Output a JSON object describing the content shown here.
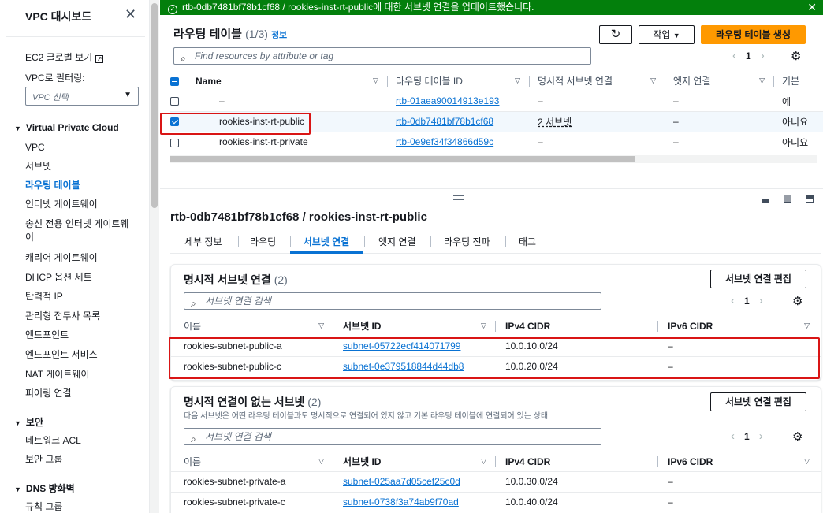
{
  "sidebar": {
    "title": "VPC 대시보드",
    "ec2_link": "EC2 글로벌 보기",
    "filter_label": "VPC로 필터링:",
    "filter_placeholder": "VPC 선택",
    "section_vpc": "Virtual Private Cloud",
    "items": [
      "VPC",
      "서브넷",
      "라우팅 테이블",
      "인터넷 게이트웨이",
      "송신 전용 인터넷 게이트웨이",
      "캐리어 게이트웨이",
      "DHCP 옵션 세트",
      "탄력적 IP",
      "관리형 접두사 목록",
      "엔드포인트",
      "엔드포인트 서비스",
      "NAT 게이트웨이",
      "피어링 연결"
    ],
    "section_security": "보안",
    "security_items": [
      "네트워크 ACL",
      "보안 그룹"
    ],
    "section_dns": "DNS 방화벽",
    "dns_items": [
      "규칙 그룹"
    ]
  },
  "banner": {
    "message": "rtb-0db7481bf78b1cf68 / rookies-inst-rt-public에 대한 서브넷 연결을 업데이트했습니다."
  },
  "route_tables": {
    "title": "라우팅 테이블",
    "count": "(1/3)",
    "info": "정보",
    "refresh_icon": "refresh-icon",
    "actions_label": "작업",
    "create_label": "라우팅 테이블 생성",
    "search_placeholder": "Find resources by attribute or tag",
    "page": "1",
    "columns": [
      "Name",
      "라우팅 테이블 ID",
      "명시적 서브넷 연결",
      "엣지 연결",
      "기본"
    ],
    "rows": [
      {
        "name": "–",
        "id": "rtb-01aea90014913e193",
        "explicit": "–",
        "edge": "–",
        "main": "예",
        "selected": false
      },
      {
        "name": "rookies-inst-rt-public",
        "id": "rtb-0db7481bf78b1cf68",
        "explicit": "2 서브넷",
        "edge": "–",
        "main": "아니요",
        "selected": true
      },
      {
        "name": "rookies-inst-rt-private",
        "id": "rtb-0e9ef34f34866d59c",
        "explicit": "–",
        "edge": "–",
        "main": "아니요",
        "selected": false
      }
    ]
  },
  "details": {
    "title": "rtb-0db7481bf78b1cf68 / rookies-inst-rt-public",
    "tabs": [
      "세부 정보",
      "라우팅",
      "서브넷 연결",
      "엣지 연결",
      "라우팅 전파",
      "태그"
    ],
    "active_tab": "서브넷 연결"
  },
  "explicit_assoc": {
    "title": "명시적 서브넷 연결",
    "count": "(2)",
    "edit_label": "서브넷 연결 편집",
    "search_placeholder": "서브넷 연결 검색",
    "page": "1",
    "columns": [
      "이름",
      "서브넷 ID",
      "IPv4 CIDR",
      "IPv6 CIDR"
    ],
    "rows": [
      {
        "name": "rookies-subnet-public-a",
        "id": "subnet-05722ecf414071799",
        "ipv4": "10.0.10.0/24",
        "ipv6": "–"
      },
      {
        "name": "rookies-subnet-public-c",
        "id": "subnet-0e379518844d44db8",
        "ipv4": "10.0.20.0/24",
        "ipv6": "–"
      }
    ]
  },
  "unassoc": {
    "title": "명시적 연결이 없는 서브넷",
    "count": "(2)",
    "edit_label": "서브넷 연결 편집",
    "description": "다음 서브넷은 어떤 라우팅 테이블과도 명시적으로 연결되어 있지 않고 기본 라우팅 테이블에 연결되어 있는 상태:",
    "search_placeholder": "서브넷 연결 검색",
    "page": "1",
    "columns": [
      "이름",
      "서브넷 ID",
      "IPv4 CIDR",
      "IPv6 CIDR"
    ],
    "rows": [
      {
        "name": "rookies-subnet-private-a",
        "id": "subnet-025aa7d05cef25c0d",
        "ipv4": "10.0.30.0/24",
        "ipv6": "–"
      },
      {
        "name": "rookies-subnet-private-c",
        "id": "subnet-0738f3a74ab9f70ad",
        "ipv4": "10.0.40.0/24",
        "ipv6": "–"
      }
    ]
  },
  "colors": {
    "success": "#037f0c",
    "link": "#0972d3",
    "primary_button": "#ff9900",
    "highlight": "#d91515"
  }
}
